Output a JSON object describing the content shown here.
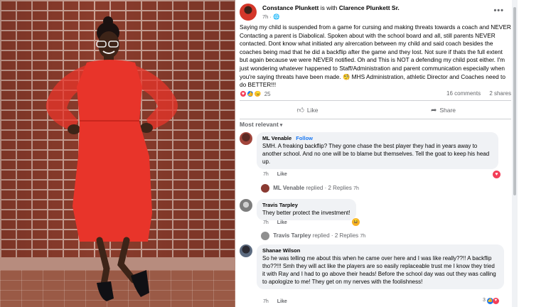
{
  "post": {
    "author": "Constance Plunkett",
    "with_text": "is with",
    "tagged": "Clarence Plunkett Sr.",
    "time": "7h",
    "privacy_icon": "globe-icon",
    "body": "Saying my child is suspended from a game for cursing and making threats towards a coach and NEVER Contacting a parent is Diabolical. Spoken about with the school board and all, still parents NEVER contacted. Dont know what initiated  any alrercation between my child and said coach besides the coaches being mad that he did a backflip after the game and they lost. Not sure if thats the full extent but again because we were NEVER notified. Oh and This is NOT a defending my child post either.  I'm just wondering whatever happened to Staff/Administration and parent communication especially when you're saying threats have been made. 🧐 MHS Administration, athletic Director and Coaches need to do BETTER!!!",
    "reaction_count": "25",
    "comments_count": "16 comments",
    "shares_count": "2 shares",
    "like_label": "Like",
    "share_label": "Share",
    "sort_label": "Most relevant"
  },
  "comments": [
    {
      "name": "ML Venable",
      "follow": "Follow",
      "text": "SMH. A freaking backflip? They gone chase the best player they had in years away to another school. And no one will be to blame but themselves. Tell the goat to keep his head up.",
      "time": "7h",
      "like": "Like",
      "reply_summary_name": "ML Venable",
      "reply_summary": "replied · 2 Replies",
      "reply_time": "7h"
    },
    {
      "name": "Travis Tarpley",
      "text": "They better protect the investment!",
      "time": "7h",
      "like": "Like",
      "reply_summary_name": "Travis Tarpley",
      "reply_summary": "replied · 2 Replies",
      "reply_time": "7h"
    },
    {
      "name": "Shanae Wilson",
      "text": "So he was telling me about this when he came over here and I was like really??!! A backflip tho??!!! Smh they will act like the players are so easily replaceable trust me I know they tried it with Ray and I had to go above their heads! Before the school day was out they was calling to apologize to me! They get on my nerves with the foolishness!",
      "time": "7h",
      "like": "Like",
      "reaction_count": "3"
    }
  ],
  "colors": {
    "accent": "#1877f2",
    "dress": "#e8342a",
    "muted": "#65676b",
    "bubble": "#f0f2f5"
  }
}
